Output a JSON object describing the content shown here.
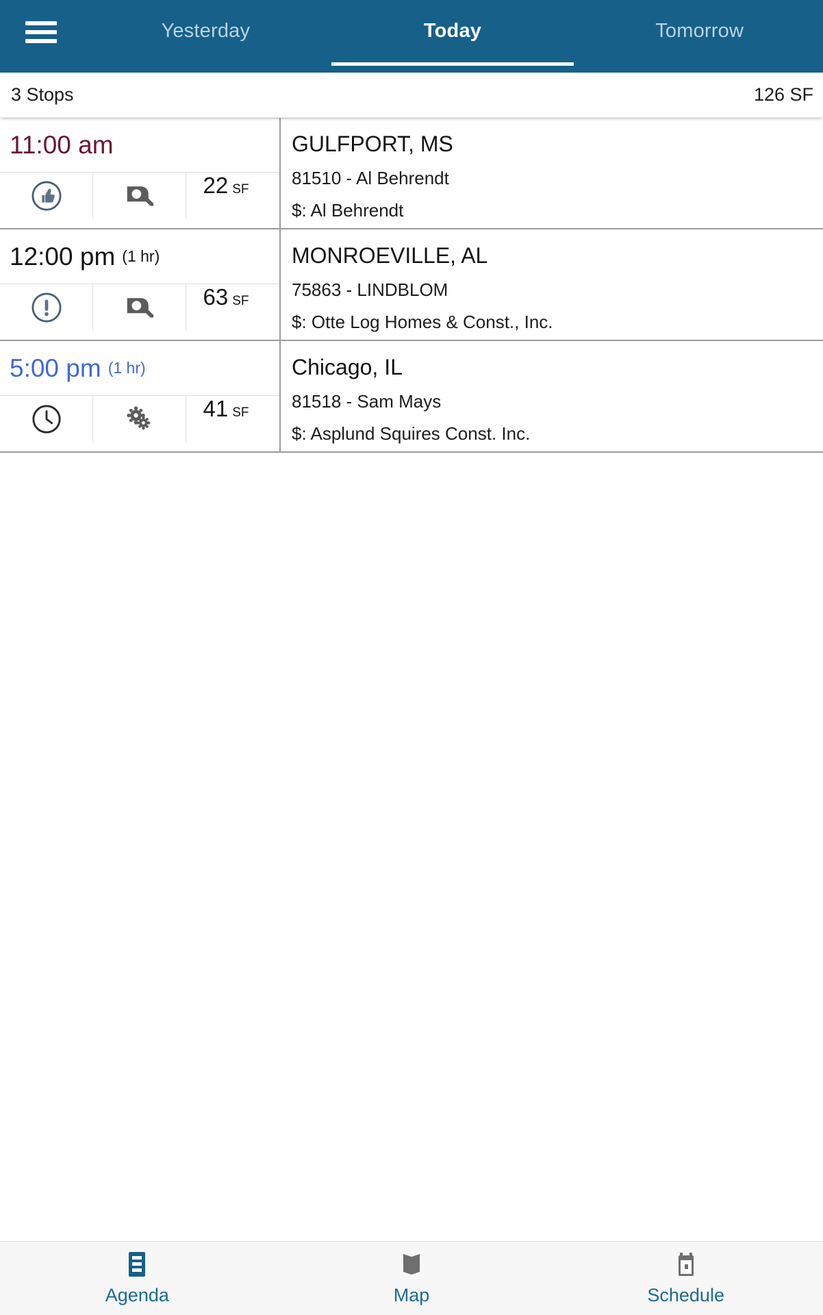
{
  "header": {
    "menu_icon": "hamburger-menu-icon",
    "tabs": [
      {
        "label": "Yesterday",
        "active": false
      },
      {
        "label": "Today",
        "active": true
      },
      {
        "label": "Tomorrow",
        "active": false
      }
    ]
  },
  "summary": {
    "stops_label": "3 Stops",
    "total_label": "126 SF"
  },
  "colors": {
    "appbar_blue": "#176089",
    "tab_inactive": "#b9d3e2",
    "time_overdue": "#6b1635",
    "time_normal": "#141414",
    "time_scheduled": "#4169d6",
    "nav_active": "#176089",
    "nav_inactive": "#6e6e6e",
    "nav_label": "#1b6b93"
  },
  "stops": [
    {
      "time": "11:00 am",
      "duration": "",
      "time_style": "maroon",
      "status_icon": "thumbs-up-circle-icon",
      "work_icon": "tape-measure-icon",
      "sf_value": "22",
      "sf_unit": "SF",
      "city": "GULFPORT, MS",
      "account": "81510 - Al Behrendt",
      "customer": "$: Al Behrendt"
    },
    {
      "time": "12:00 pm",
      "duration": "(1 hr)",
      "time_style": "black",
      "status_icon": "exclamation-circle-icon",
      "work_icon": "tape-measure-icon",
      "sf_value": "63",
      "sf_unit": "SF",
      "city": "MONROEVILLE, AL",
      "account": "75863 - LINDBLOM",
      "customer": "$: Otte Log Homes & Const., Inc."
    },
    {
      "time": "5:00 pm",
      "duration": "(1 hr)",
      "time_style": "blue",
      "status_icon": "clock-icon",
      "work_icon": "gears-icon",
      "sf_value": "41",
      "sf_unit": "SF",
      "city": "Chicago, IL",
      "account": "81518 - Sam Mays",
      "customer": "$: Asplund Squires Const. Inc."
    }
  ],
  "bottom_nav": [
    {
      "label": "Agenda",
      "icon": "agenda-list-icon",
      "active": true
    },
    {
      "label": "Map",
      "icon": "map-icon",
      "active": false
    },
    {
      "label": "Schedule",
      "icon": "calendar-icon",
      "active": false
    }
  ]
}
